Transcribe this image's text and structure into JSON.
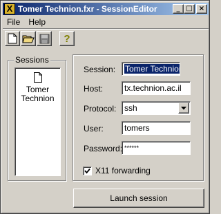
{
  "window": {
    "title": "Tomer Technion.fxr - SessionEditor",
    "app_icon_letter": "X"
  },
  "titlebar_buttons": {
    "minimize": "_",
    "maximize": "□",
    "close": "×"
  },
  "menu": [
    {
      "label": "File"
    },
    {
      "label": "Help"
    }
  ],
  "toolbar": {
    "new": "new-document-icon",
    "open": "open-folder-icon",
    "save": "save-disk-icon",
    "help": "help-question-icon"
  },
  "sessions": {
    "group_label": "Sessions",
    "items": [
      {
        "name_line1": "Tomer",
        "name_line2": "Technion"
      }
    ]
  },
  "form": {
    "session_label": "Session:",
    "session_value": "Tomer Technion",
    "host_label": "Host:",
    "host_value": "tx.technion.ac.il",
    "protocol_label": "Protocol:",
    "protocol_value": "ssh",
    "user_label": "User:",
    "user_value": "tomers",
    "password_label": "Password:",
    "password_value": "******",
    "x11_label": "X11 forwarding",
    "x11_checked": true
  },
  "launch_button": "Launch session",
  "colors": {
    "face": "#d4d0c8",
    "title_start": "#0a246a",
    "title_end": "#a6caf0",
    "selection": "#0a246a"
  }
}
